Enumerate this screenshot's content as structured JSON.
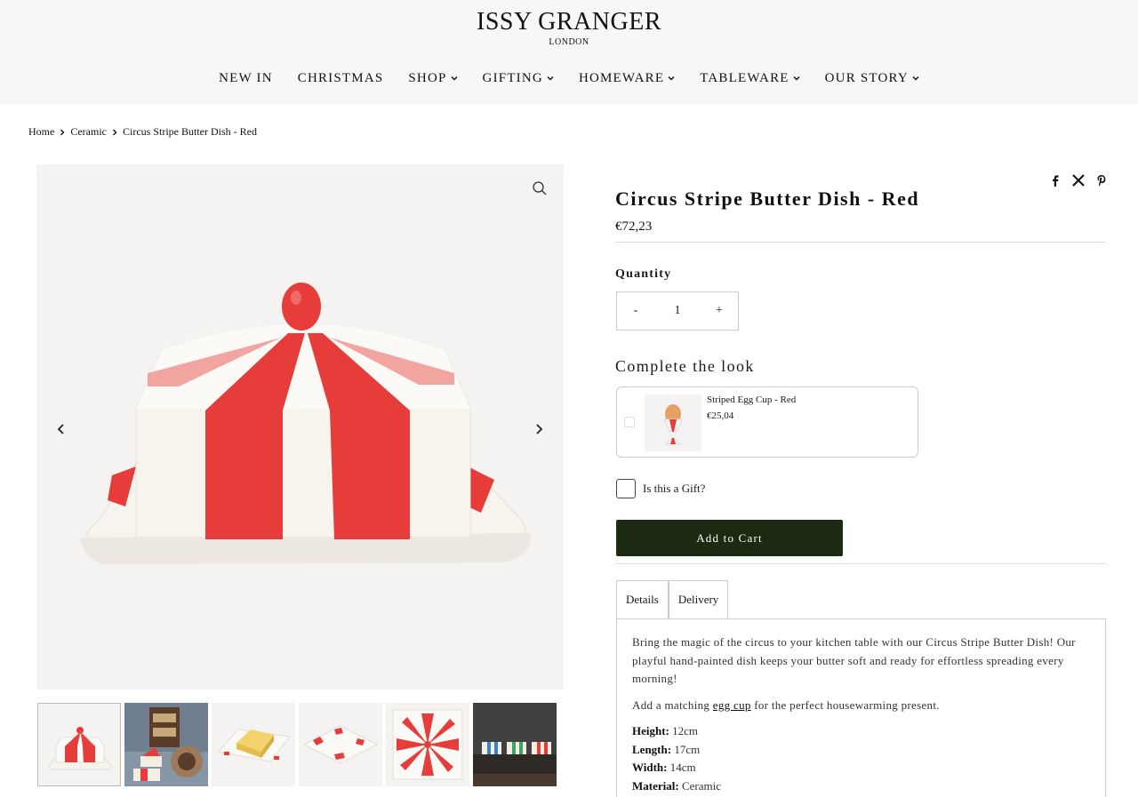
{
  "header": {
    "brand": "ISSY GRANGER",
    "brand_sub": "LONDON",
    "nav": [
      {
        "label": "NEW IN",
        "dropdown": false
      },
      {
        "label": "CHRISTMAS",
        "dropdown": false
      },
      {
        "label": "SHOP",
        "dropdown": true
      },
      {
        "label": "GIFTING",
        "dropdown": true
      },
      {
        "label": "HOMEWARE",
        "dropdown": true
      },
      {
        "label": "TABLEWARE",
        "dropdown": true
      },
      {
        "label": "OUR STORY",
        "dropdown": true
      }
    ]
  },
  "breadcrumb": [
    "Home",
    "Ceramic",
    "Circus Stripe Butter Dish - Red"
  ],
  "gallery": {
    "thumbnail_count": 6,
    "active_index": 0
  },
  "product": {
    "title": "Circus Stripe Butter Dish - Red",
    "price": "€72,23",
    "quantity_label": "Quantity",
    "quantity_minus": "-",
    "quantity_value": "1",
    "quantity_plus": "+",
    "complete_look_label": "Complete the look",
    "complete_look_item": {
      "name": "Striped Egg Cup - Red",
      "price": "€25,04",
      "checked": false
    },
    "gift_label": "Is this a Gift?",
    "gift_checked": false,
    "add_to_cart": "Add to Cart",
    "tabs": [
      "Details",
      "Delivery"
    ],
    "active_tab": "Details",
    "description": "Bring the magic of the circus to your kitchen table with our Circus Stripe Butter Dish! Our playful hand-painted dish keeps your butter soft and ready for effortless spreading every morning!",
    "matching_prefix": "Add a matching ",
    "matching_link": "egg cup",
    "matching_suffix": " for the perfect housewarming present.",
    "specs": [
      {
        "label": "Height:",
        "value": " 12cm"
      },
      {
        "label": "Length:",
        "value": " 17cm"
      },
      {
        "label": "Width:",
        "value": " 14cm"
      },
      {
        "label": "Material:",
        "value": " Ceramic"
      }
    ]
  },
  "colors": {
    "accent_red": "#e63d3a",
    "cart_button": "#1c2a12",
    "header_bg": "#f7f7f7",
    "image_bg": "#f4f3f1"
  },
  "icons": [
    "chevron-down-icon",
    "chevron-right-icon",
    "zoom-icon",
    "arrow-left-icon",
    "arrow-right-icon",
    "facebook-icon",
    "x-icon",
    "pinterest-icon"
  ]
}
